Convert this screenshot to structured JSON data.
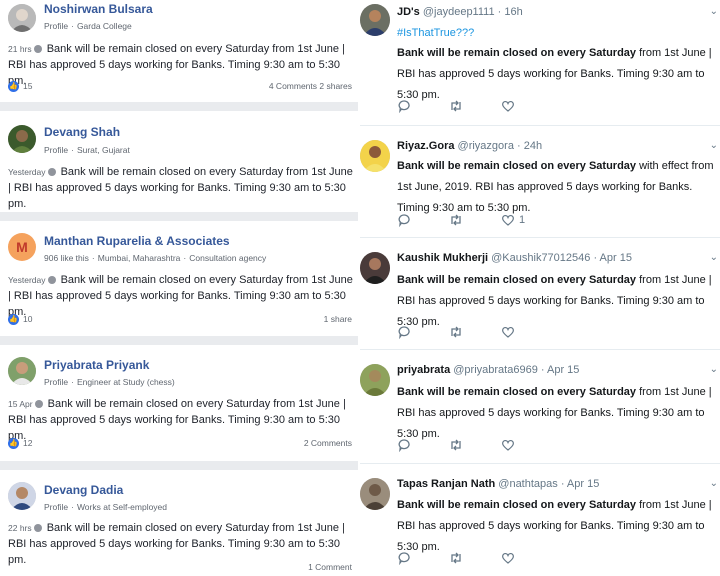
{
  "facebook_posts": [
    {
      "name": "Noshirwan Bulsara",
      "meta1": "Profile",
      "meta2": "Garda College",
      "time": "21 hrs",
      "text": "Bank will be remain closed on every Saturday from 1st June | RBI has approved 5 days working for Banks. Timing 9:30 am to 5:30 pm.",
      "likes": "15",
      "counts": "4 Comments 2 shares"
    },
    {
      "name": "Devang Shah",
      "meta1": "Profile",
      "meta2": "Surat, Gujarat",
      "time": "Yesterday",
      "text": "Bank will be remain closed on every Saturday from 1st June | RBI has approved 5 days working for Banks. Timing 9:30 am to 5:30 pm.",
      "likes": "",
      "counts": ""
    },
    {
      "name": "Manthan Ruparelia & Associates",
      "avatar_letter": "M",
      "meta1": "906 like this",
      "meta2": "Mumbai, Maharashtra",
      "meta3": "Consultation agency",
      "time": "Yesterday",
      "text": "Bank will be remain closed on every Saturday from 1st June | RBI has approved 5 days working for Banks. Timing 9:30 am to 5:30 pm.",
      "likes": "10",
      "counts": "1 share"
    },
    {
      "name": "Priyabrata Priyank",
      "meta1": "Profile",
      "meta2": "Engineer at Study (chess)",
      "time": "15 Apr",
      "text": "Bank will be remain closed on every Saturday from 1st June | RBI has approved 5 days working for Banks. Timing 9:30 am to 5:30 pm.",
      "likes": "12",
      "counts": "2 Comments"
    },
    {
      "name": "Devang Dadia",
      "meta1": "Profile",
      "meta2": "Works at Self-employed",
      "time": "22 hrs",
      "text": "Bank will be remain closed on every Saturday from 1st June | RBI has approved 5 days working for Banks. Timing 9:30 am to 5:30 pm.",
      "likes": "",
      "counts": "1 Comment"
    }
  ],
  "tweets": [
    {
      "name": "JD's",
      "handle": "@jaydeep1111 · 16h",
      "hashtag": "#IsThatTrue???",
      "bold": "Bank will be remain closed on every Saturday",
      "rest": " from 1st June | RBI has approved 5 days working for Banks. Timing 9:30 am to 5:30 pm.",
      "like_count": ""
    },
    {
      "name": "Riyaz.Gora",
      "handle": "@riyazgora · 24h",
      "bold": "Bank will be remain closed on every Saturday",
      "rest": " with effect from 1st June, 2019. RBI has approved 5 days working for Banks. Timing 9:30 am to 5:30 pm.",
      "like_count": "1"
    },
    {
      "name": "Kaushik Mukherji",
      "handle": "@Kaushik77012546 · Apr 15",
      "bold": "Bank will be remain closed on every Saturday",
      "rest": " from 1st June | RBI has approved 5 days working for Banks. Timing 9:30 am to 5:30 pm.",
      "like_count": ""
    },
    {
      "name": "priyabrata",
      "handle": "@priyabrata6969 · Apr 15",
      "bold": "Bank will be remain closed on every Saturday",
      "rest": " from 1st June | RBI has approved 5 days working for Banks. Timing 9:30 am to 5:30 pm.",
      "like_count": ""
    },
    {
      "name": "Tapas Ranjan Nath",
      "handle": "@nathtapas · Apr 15",
      "bold": "Bank will be remain closed on every Saturday",
      "rest": " from 1st June | RBI has approved 5 days working for Banks. Timing 9:30 am to 5:30 pm.",
      "like_count": ""
    }
  ],
  "icons": {
    "reply": "reply-icon",
    "retweet": "retweet-icon",
    "like": "heart-icon",
    "menu": "chevron-down-icon",
    "reaction": "thumbs-up-icon",
    "privacy": "globe-icon"
  },
  "colors": {
    "fb_link": "#365899",
    "tw_link": "#1b95e0",
    "like_blue": "#2f6fe8",
    "separator": "#e9ebee"
  }
}
